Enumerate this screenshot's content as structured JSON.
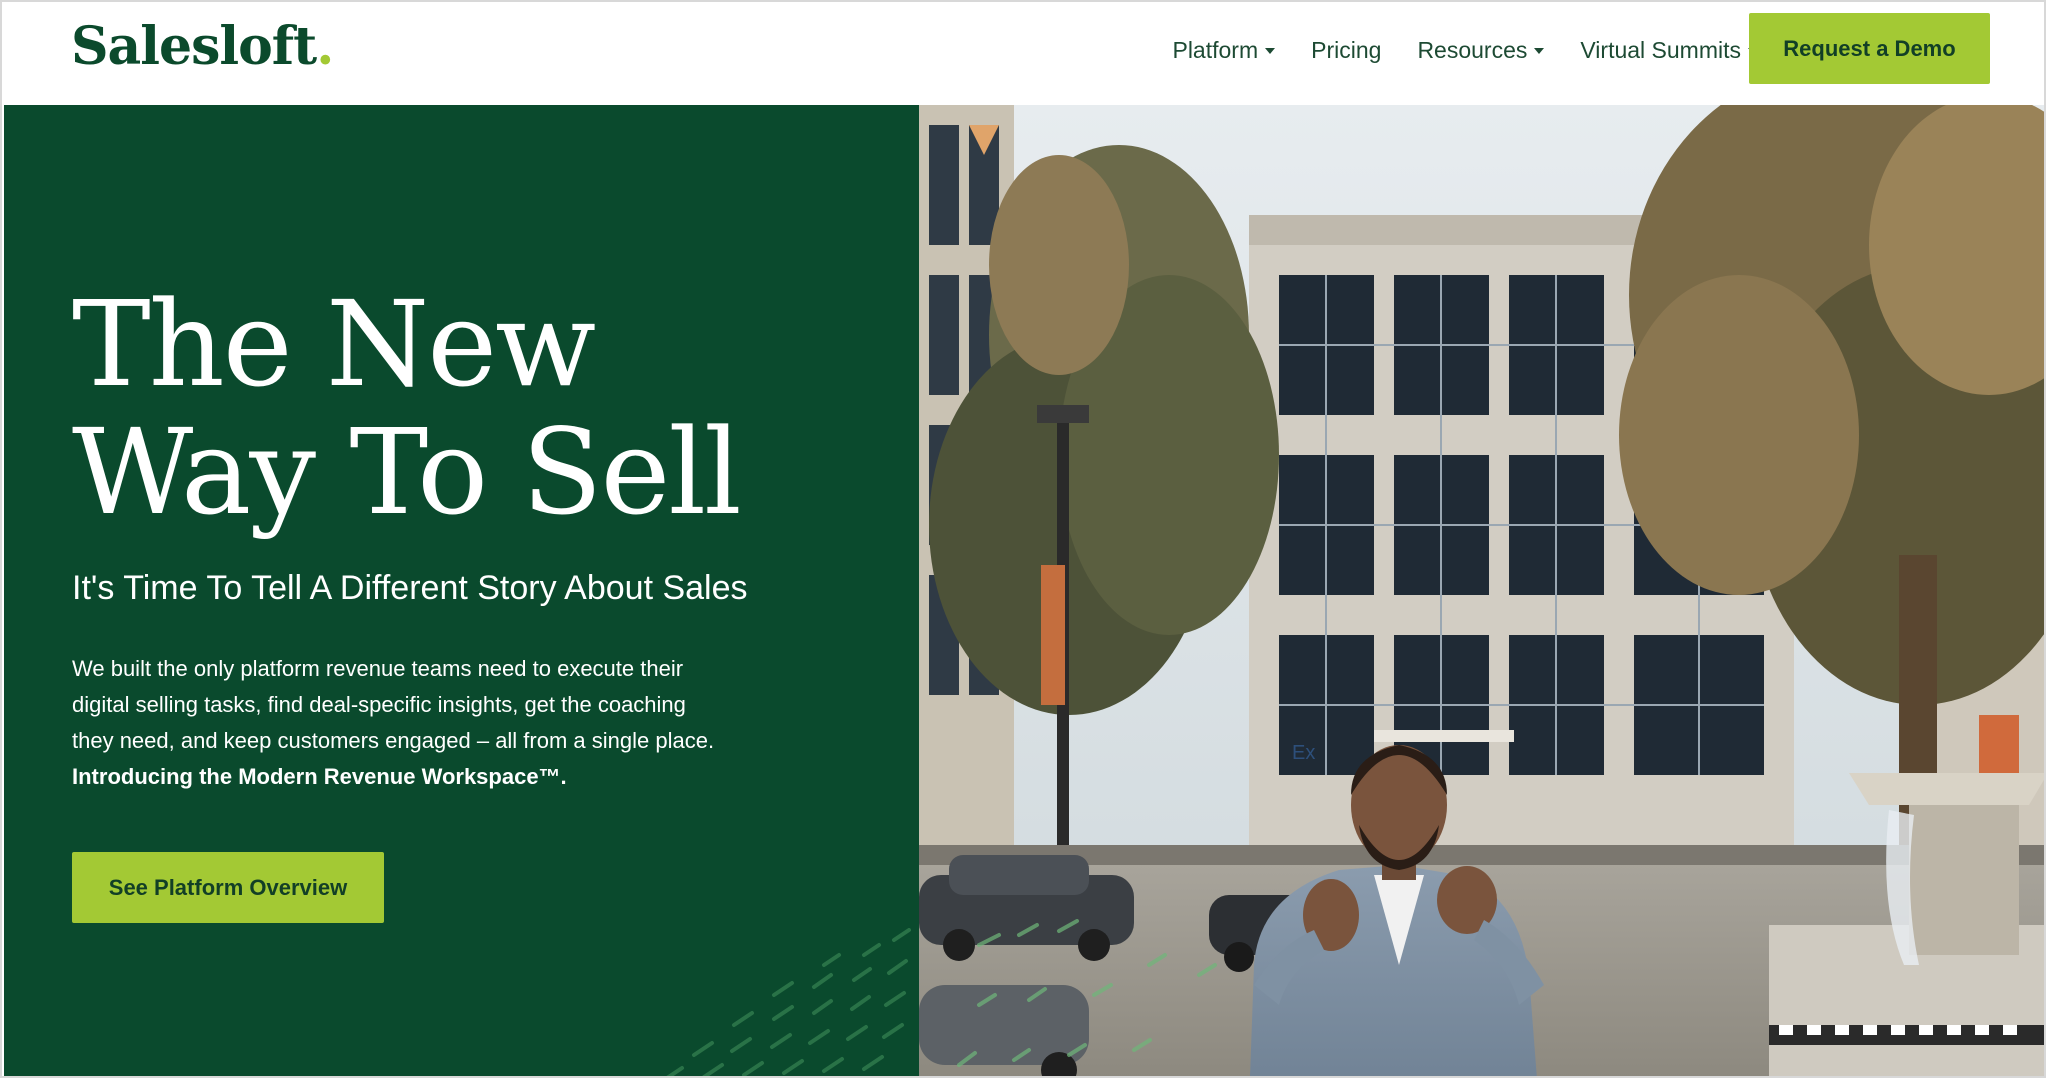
{
  "header": {
    "logo_text": "Salesloft",
    "logo_dot": ".",
    "nav": [
      {
        "label": "Platform",
        "has_caret": true
      },
      {
        "label": "Pricing",
        "has_caret": false
      },
      {
        "label": "Resources",
        "has_caret": true
      },
      {
        "label": "Virtual Summits",
        "has_caret": true
      }
    ],
    "demo_label": "Request a Demo"
  },
  "hero": {
    "headline_line1": "The New",
    "headline_line2": "Way To Sell",
    "subhead": "It's Time To Tell A Different Story About Sales",
    "body_line1": "We built the only platform revenue teams need to execute their",
    "body_line2": "digital selling tasks, find deal-specific insights, get the coaching",
    "body_line3": "they need, and keep customers engaged – all from a single place.",
    "body_strong": "Introducing the Modern Revenue Workspace™.",
    "cta_label": "See Platform Overview"
  },
  "video": {
    "building_sign": "Ex"
  },
  "colors": {
    "brand_green": "#0a4a2d",
    "accent_lime": "#a3c934",
    "nav_text": "#1d4a33"
  }
}
